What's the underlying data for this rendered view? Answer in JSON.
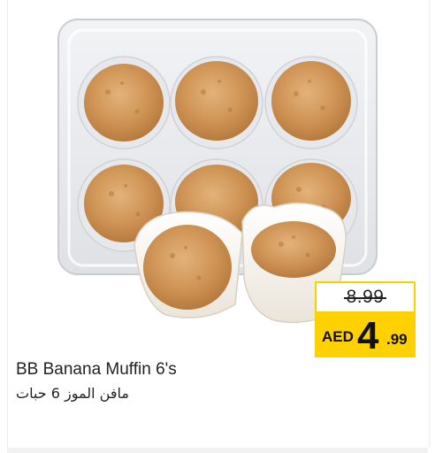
{
  "product": {
    "name": "BB Banana Muffin 6's",
    "name_ar": "مافن الموز 6 حبات"
  },
  "price": {
    "old": "8.99",
    "currency": "AED",
    "main": "4",
    "decimal": ".99"
  },
  "colors": {
    "price_highlight": "#ffd100",
    "old_price_border": "#f7d000"
  }
}
